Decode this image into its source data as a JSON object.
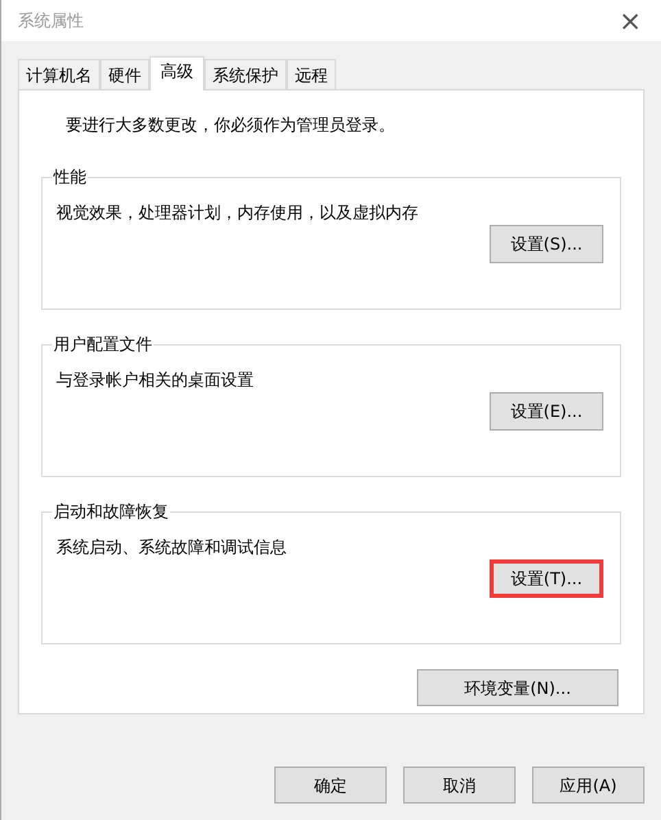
{
  "window": {
    "title": "系统属性",
    "close": "×"
  },
  "tabs": [
    {
      "label": "计算机名",
      "selected": false
    },
    {
      "label": "硬件",
      "selected": false
    },
    {
      "label": "高级",
      "selected": true
    },
    {
      "label": "系统保护",
      "selected": false
    },
    {
      "label": "远程",
      "selected": false
    }
  ],
  "notice": "要进行大多数更改，你必须作为管理员登录。",
  "groups": [
    {
      "title": "性能",
      "description": "视觉效果，处理器计划，内存使用，以及虚拟内存",
      "button": {
        "label": "设置(S)...",
        "highlighted": false
      }
    },
    {
      "title": "用户配置文件",
      "description": "与登录帐户相关的桌面设置",
      "button": {
        "label": "设置(E)...",
        "highlighted": false
      }
    },
    {
      "title": "启动和故障恢复",
      "description": "系统启动、系统故障和调试信息",
      "button": {
        "label": "设置(T)...",
        "highlighted": true
      }
    }
  ],
  "env_button": "环境变量(N)...",
  "dialog_buttons": [
    "确定",
    "取消",
    "应用(A)"
  ]
}
